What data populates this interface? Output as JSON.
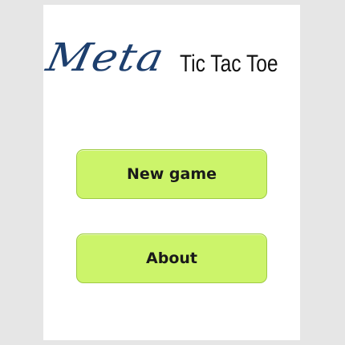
{
  "logo": {
    "script_text": "Meta",
    "title_text": "Tic Tac Toe"
  },
  "menu": {
    "new_game_label": "New game",
    "about_label": "About"
  },
  "colors": {
    "background": "#e6e6e6",
    "panel": "#ffffff",
    "logo_script": "#1d3f6e",
    "button_fill": "#ccf46a",
    "button_border": "#9fcb44"
  }
}
